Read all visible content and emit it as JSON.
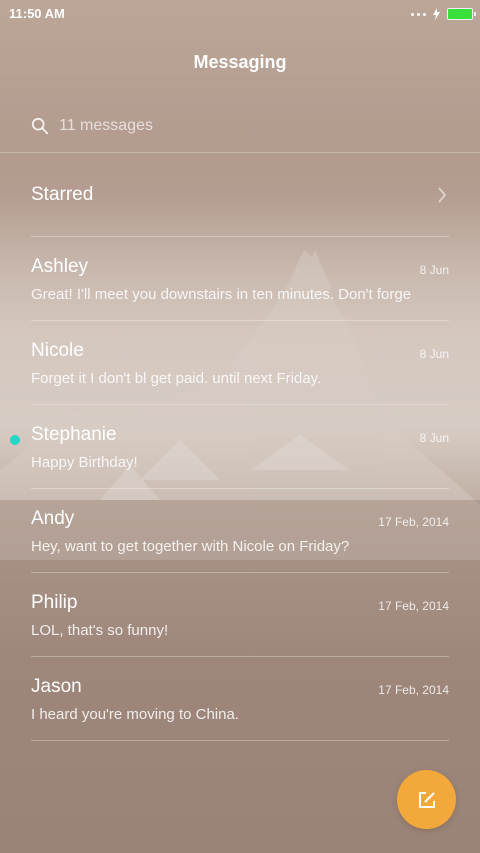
{
  "status_bar": {
    "time": "11:50 AM",
    "battery_color": "#39df3a"
  },
  "header": {
    "title": "Messaging"
  },
  "search": {
    "icon": "search-icon",
    "placeholder": "11 messages"
  },
  "starred": {
    "label": "Starred",
    "icon": "chevron-right-icon"
  },
  "messages": [
    {
      "sender": "Ashley",
      "date": "8 Jun",
      "preview": "Great! I'll meet you downstairs in ten minutes. Don't forge",
      "unread": false
    },
    {
      "sender": "Nicole",
      "date": "8 Jun",
      "preview": "Forget it I don't bl get paid. until next Friday.",
      "unread": false
    },
    {
      "sender": "Stephanie",
      "date": "8 Jun",
      "preview": "Happy Birthday!",
      "unread": true
    },
    {
      "sender": "Andy",
      "date": "17 Feb, 2014",
      "preview": "Hey, want to get together with Nicole on Friday?",
      "unread": false
    },
    {
      "sender": "Philip",
      "date": "17 Feb, 2014",
      "preview": "LOL, that's so funny!",
      "unread": false
    },
    {
      "sender": "Jason",
      "date": "17 Feb, 2014",
      "preview": "I heard you're moving to China.",
      "unread": false
    }
  ],
  "compose": {
    "icon": "compose-icon",
    "color": "#f2a83a"
  },
  "colors": {
    "unread_dot": "#23d6c5",
    "accent": "#f2a83a"
  }
}
